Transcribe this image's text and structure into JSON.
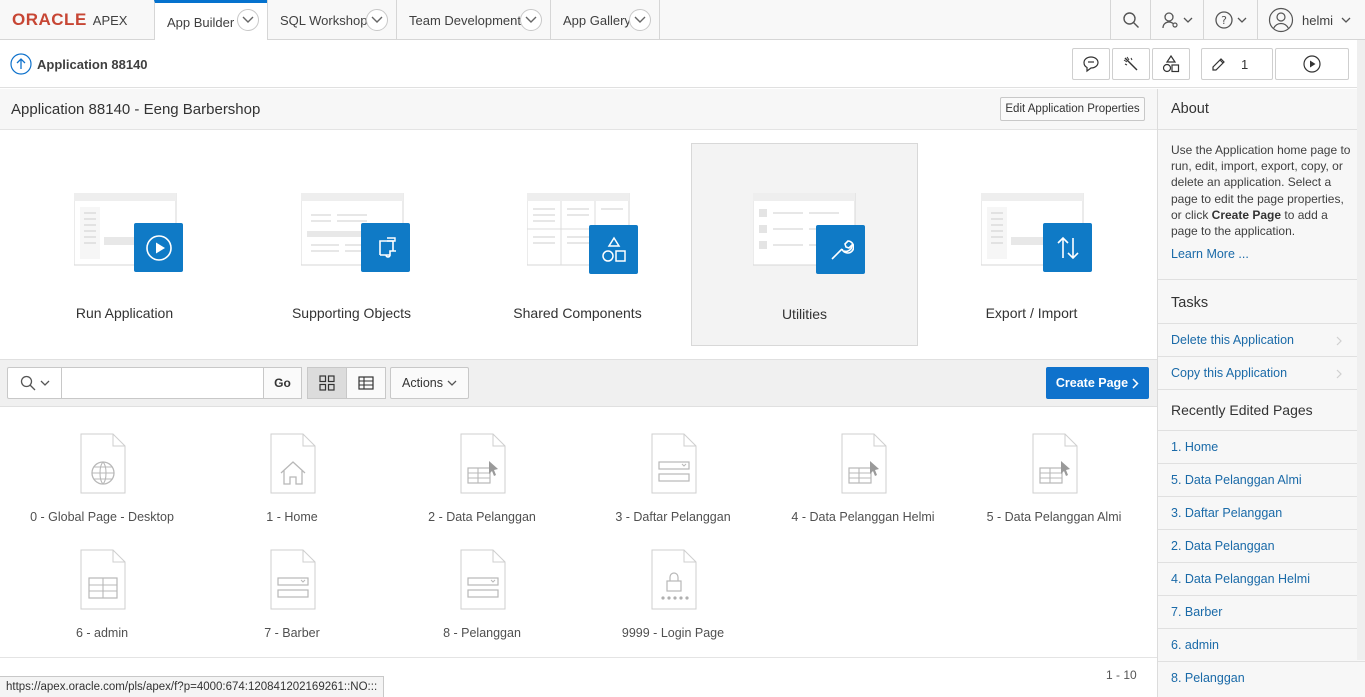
{
  "topnav": {
    "logo_oracle": "ORACLE",
    "logo_apex": "APEX",
    "tabs": [
      "App Builder",
      "SQL Workshop",
      "Team Development",
      "App Gallery"
    ],
    "user": "helmi"
  },
  "appbar": {
    "title": "Application 88140",
    "edit_count": "1"
  },
  "main": {
    "header_title": "Application 88140 - Eeng Barbershop",
    "edit_props": "Edit Application Properties",
    "tiles": [
      "Run Application",
      "Supporting Objects",
      "Shared Components",
      "Utilities",
      "Export / Import"
    ],
    "go": "Go",
    "actions": "Actions",
    "create_page": "Create Page",
    "search_value": "",
    "pages": [
      "0 - Global Page - Desktop",
      "1 - Home",
      "2 - Data Pelanggan",
      "3 - Daftar Pelanggan",
      "4 - Data Pelanggan Helmi",
      "5 - Data Pelanggan Almi",
      "6 - admin",
      "7 - Barber",
      "8 - Pelanggan",
      "9999 - Login Page"
    ],
    "pager": "1 - 10"
  },
  "status_url": "https://apex.oracle.com/pls/apex/f?p=4000:674:120841202169261::NO:::",
  "side": {
    "about_heading": "About",
    "about_text_1": "Use the Application home page to run, edit, import, export, copy, or delete an application. Select a page to edit the page properties, or click ",
    "about_text_bold": "Create Page",
    "about_text_2": " to add a page to the application.",
    "learn_more": "Learn More ...",
    "tasks_heading": "Tasks",
    "tasks": [
      "Delete this Application",
      "Copy this Application"
    ],
    "recent_heading": "Recently Edited Pages",
    "recent": [
      "1. Home",
      "5. Data Pelanggan Almi",
      "3. Daftar Pelanggan",
      "2. Data Pelanggan",
      "4. Data Pelanggan Helmi",
      "7. Barber",
      "6. admin",
      "8. Pelanggan"
    ]
  },
  "colors": {
    "accent": "#0f72cc",
    "oracle_red": "#c74634",
    "tile_blue": "#0f7ac6",
    "link": "#1a6aa8"
  }
}
